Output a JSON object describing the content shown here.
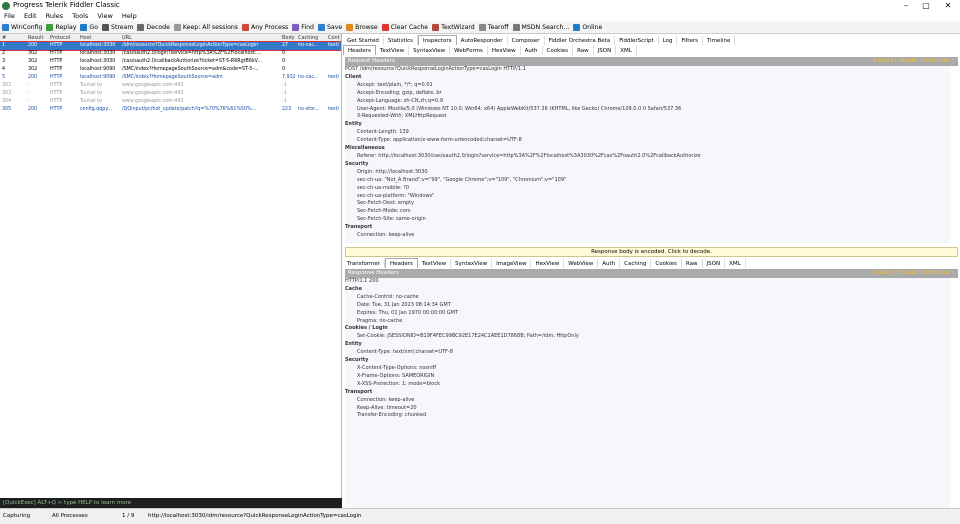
{
  "window": {
    "title": "Progress Telerik Fiddler Classic",
    "min": "–",
    "max": "▢",
    "close": "✕"
  },
  "menu": [
    "File",
    "Edit",
    "Rules",
    "Tools",
    "View",
    "Help"
  ],
  "toolbar": [
    {
      "label": "WinConfig",
      "color": "#2f7fd0"
    },
    {
      "label": "Replay",
      "color": "#3f9f3f"
    },
    {
      "label": "Go",
      "color": "#1c7cc8"
    },
    {
      "label": "Stream",
      "color": "#555"
    },
    {
      "label": "Decode",
      "color": "#6a6a6a"
    },
    {
      "label": "Keep: All sessions",
      "color": "#999"
    },
    {
      "label": "Any Process",
      "color": "#d04a3c"
    },
    {
      "label": "Find",
      "color": "#7d5fbf"
    },
    {
      "label": "Save",
      "color": "#2f7fd0"
    },
    {
      "label": "Browse",
      "color": "#e08a1e"
    },
    {
      "label": "Clear Cache",
      "color": "#d33"
    },
    {
      "label": "TextWizard",
      "color": "#b5473c"
    },
    {
      "label": "Tearoff",
      "color": "#888"
    },
    {
      "label": "MSDN Search...",
      "color": "#777"
    },
    {
      "label": "Online",
      "color": "#1c7cc8"
    }
  ],
  "sessions": {
    "headers": [
      "#",
      "Result",
      "Protocol",
      "Host",
      "URL",
      "Body",
      "Caching",
      "Cont"
    ],
    "rows": [
      [
        "1",
        "200",
        "HTTP",
        "localhost:3030",
        "/idm/resource?QuickResponseLoginActionType=casLogin",
        "27",
        "no-cac...",
        "text/"
      ],
      [
        "2",
        "302",
        "HTTP",
        "localhost:3030",
        "/cas/oauth2.0/login?service=http%3A%2F%2Flocalhost:...",
        "0",
        "",
        ""
      ],
      [
        "3",
        "302",
        "HTTP",
        "localhost:3030",
        "/cas/oauth2.0/callbackAuthorize?ticket=ST-5-R6RgtB6kV...",
        "0",
        "",
        ""
      ],
      [
        "4",
        "302",
        "HTTP",
        "localhost:9090",
        "/SMC/index?HomepageSouthSource=adm&code=ST-5-...",
        "0",
        "",
        ""
      ],
      [
        "5",
        "200",
        "HTTP",
        "localhost:9090",
        "/SMC/index?HomepageSouthSource=adm",
        "7,932",
        "no-cac...",
        "text/"
      ],
      [
        "302",
        "-",
        "HTTP",
        "Tunnel to",
        "www.googleapis.com:443",
        "-1",
        "",
        ""
      ],
      [
        "303",
        "-",
        "HTTP",
        "Tunnel to",
        "www.googleapis.com:443",
        "-1",
        "",
        ""
      ],
      [
        "304",
        "-",
        "HTTP",
        "Tunnel to",
        "www.googleapis.com:443",
        "-1",
        "",
        ""
      ],
      [
        "305",
        "200",
        "HTTP",
        "config.qqpy...",
        "/QQinput/pc/hot_update/patch?q=%70%76%61%50%...",
        "223",
        "no-stor...",
        "text/"
      ]
    ]
  },
  "quickexec": "[QuickExec] ALT+Q > type HELP to learn more",
  "status": {
    "capturing": "Capturing",
    "process": "All Processes",
    "count": "1 / 9",
    "url": "http://localhost:3030/idm/resource?QuickResponseLoginActionType=casLogin"
  },
  "topTabs": [
    "Get Started",
    "Statistics",
    "Inspectors",
    "AutoResponder",
    "Composer",
    "Fiddler Orchestra Beta",
    "FiddlerScript",
    "Log",
    "Filters",
    "Timeline"
  ],
  "reqTabs": [
    "Headers",
    "TextView",
    "SyntaxView",
    "WebForms",
    "HexView",
    "Auth",
    "Cookies",
    "Raw",
    "JSON",
    "XML"
  ],
  "request": {
    "title": "Request Headers",
    "raw": "[ Raw ]",
    "defs": "[ Header Definitions ]",
    "line": "POST /idm/resource?QuickResponseLoginActionType=casLogin HTTP/1.1",
    "groups": [
      {
        "name": "Client",
        "items": [
          "Accept: text/plain, */*; q=0.01",
          "Accept-Encoding: gzip, deflate, br",
          "Accept-Language: zh-CN,zh;q=0.9",
          "User-Agent: Mozilla/5.0 (Windows NT 10.0; Win64; x64) AppleWebKit/537.36 (KHTML, like Gecko) Chrome/109.0.0.0 Safari/537.36",
          "X-Requested-With: XMLHttpRequest"
        ]
      },
      {
        "name": "Entity",
        "items": [
          "Content-Length: 139",
          "Content-Type: application/x-www-form-urlencoded;charset=UTF-8"
        ]
      },
      {
        "name": "Miscellaneous",
        "items": [
          "Referer: http://localhost:3030/cas/oauth2.0/login?service=http%3A%2F%2Flocalhost%3A3030%2Fcas%2Foauth2.0%2FcallbackAuthorize"
        ]
      },
      {
        "name": "Security",
        "items": [
          "Origin: http://localhost:3030",
          "sec-ch-ua: \"Not_A Brand\";v=\"99\", \"Google Chrome\";v=\"109\", \"Chromium\";v=\"109\"",
          "sec-ch-ua-mobile: ?0",
          "sec-ch-ua-platform: \"Windows\"",
          "Sec-Fetch-Dest: empty",
          "Sec-Fetch-Mode: cors",
          "Sec-Fetch-Site: same-origin"
        ]
      },
      {
        "name": "Transport",
        "items": [
          "Connection: keep-alive"
        ]
      }
    ]
  },
  "notice": "Response body is encoded. Click to decode.",
  "respTabs": [
    "Transformer",
    "Headers",
    "TextView",
    "SyntaxView",
    "ImageView",
    "HexView",
    "WebView",
    "Auth",
    "Caching",
    "Cookies",
    "Raw",
    "JSON",
    "XML"
  ],
  "response": {
    "title": "Response Headers",
    "raw": "[ Raw ]",
    "defs": "[ Header Definitions ]",
    "line": "HTTP/1.1 200",
    "groups": [
      {
        "name": "Cache",
        "items": [
          "Cache-Control: no-cache",
          "Date: Tue, 31 Jan 2023 08:14:34 GMT",
          "Expires: Thu, 01 Jan 1970 00:00:00 GMT",
          "Pragma: no-cache"
        ]
      },
      {
        "name": "Cookies / Login",
        "items": [
          "Set-Cookie: JSESSIONID=B19F4FEC99BC92E17E24C2AEE1D7868B; Path=/idm; HttpOnly"
        ]
      },
      {
        "name": "Entity",
        "items": [
          "Content-Type: text/xml;charset=UTF-8"
        ]
      },
      {
        "name": "Security",
        "items": [
          "X-Content-Type-Options: nosniff",
          "X-Frame-Options: SAMEORIGIN",
          "X-XSS-Protection: 1; mode=block"
        ]
      },
      {
        "name": "Transport",
        "items": [
          "Connection: keep-alive",
          "Keep-Alive: timeout=20",
          "Transfer-Encoding: chunked"
        ]
      }
    ]
  }
}
